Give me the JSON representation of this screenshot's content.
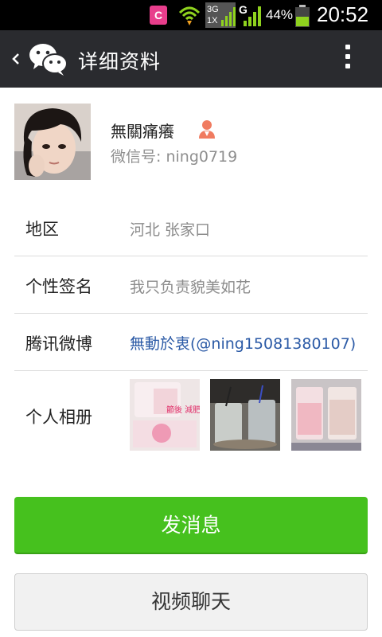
{
  "status_bar": {
    "app_badge": "C",
    "network": "3G",
    "network_sub": "1X",
    "signal_type": "G",
    "battery_percent": "44%",
    "time": "20:52"
  },
  "header": {
    "title": "详细资料"
  },
  "profile": {
    "name": "無關痛癢",
    "wechat_id_label": "微信号:",
    "wechat_id": "ning0719"
  },
  "details": [
    {
      "label": "地区",
      "value": "河北  张家口"
    },
    {
      "label": "个性签名",
      "value": "我只负责貌美如花"
    },
    {
      "label": "腾讯微博",
      "value": "無動於衷(@ning15081380107)"
    },
    {
      "label": "个人相册",
      "value": ""
    }
  ],
  "album": {
    "thumb_1_text": "節後 減肥"
  },
  "actions": {
    "send_message": "发消息",
    "video_chat": "视频聊天"
  },
  "colors": {
    "accent_green": "#46c11e",
    "header_bg": "#2a2b2f",
    "link_blue": "#2b5aa6"
  },
  "icons": {
    "back": "chevron-left-icon",
    "logo": "wechat-logo-icon",
    "menu": "more-vertical-icon",
    "gender": "female-icon"
  }
}
